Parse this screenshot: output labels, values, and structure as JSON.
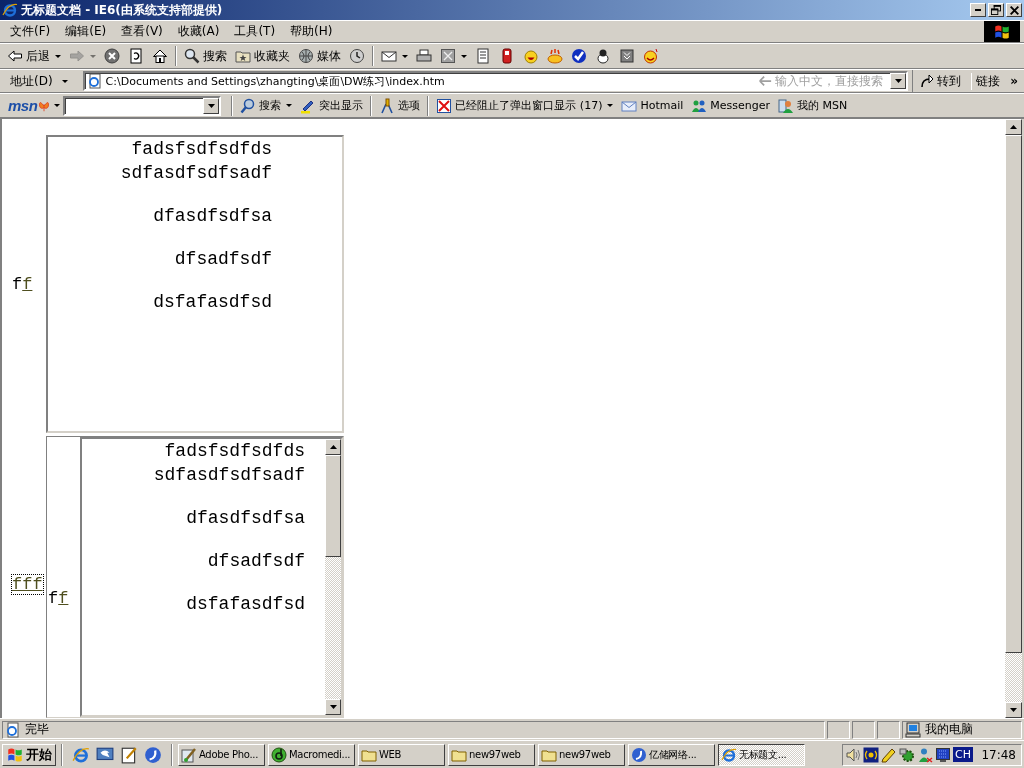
{
  "window": {
    "title": "无标题文档 - IE6(由系统支持部提供)"
  },
  "menu": [
    "文件(F)",
    "编辑(E)",
    "查看(V)",
    "收藏(A)",
    "工具(T)",
    "帮助(H)"
  ],
  "toolbar": {
    "groups": [
      {
        "items": [
          {
            "label": "后退",
            "dropdown": true,
            "disabled": false
          },
          {
            "dropdown": true,
            "disabled": true
          },
          {
            "dropdown": false,
            "disabled": false
          },
          {
            "dropdown": false,
            "disabled": false
          },
          {
            "dropdown": false,
            "disabled": false
          }
        ]
      },
      {
        "items": [
          {
            "label": "搜索",
            "dropdown": false,
            "disabled": false
          },
          {
            "label": "收藏夹",
            "dropdown": false,
            "disabled": false
          },
          {
            "label": "媒体",
            "dropdown": false,
            "disabled": false
          },
          {
            "dropdown": false,
            "disabled": false
          }
        ]
      },
      {
        "items": [
          {
            "dropdown": true,
            "disabled": false
          },
          {
            "dropdown": false,
            "disabled": false
          },
          {
            "dropdown": true,
            "disabled": false
          },
          {
            "dropdown": false,
            "disabled": false
          },
          {
            "dropdown": false,
            "disabled": false
          },
          {
            "dropdown": false,
            "disabled": false
          },
          {
            "dropdown": false,
            "disabled": false
          },
          {
            "dropdown": false,
            "disabled": false
          },
          {
            "dropdown": false,
            "disabled": false
          },
          {
            "dropdown": false,
            "disabled": false
          },
          {
            "dropdown": false,
            "disabled": false
          }
        ]
      }
    ]
  },
  "address_bar": {
    "label": "地址(D)",
    "value": "C:\\Documents and Settings\\zhangting\\桌面\\DW练习\\index.htm",
    "hint": "输入中文，直接搜索",
    "go": "转到",
    "links": "链接",
    "more": "»"
  },
  "msn_bar": {
    "logo": "msn",
    "groups": [
      {
        "items": [
          {
            "label": "搜索",
            "dropdown": true
          },
          {
            "label": "突出显示",
            "dropdown": false
          }
        ]
      },
      {
        "items": [
          {
            "label": "选项",
            "dropdown": false
          }
        ]
      },
      {
        "items": [
          {
            "label": "已经阻止了弹出窗口显示 (17)",
            "dropdown": true
          },
          {
            "label": "Hotmail",
            "dropdown": false
          },
          {
            "label": "Messenger",
            "dropdown": false
          },
          {
            "label": "我的 MSN",
            "dropdown": false
          }
        ]
      }
    ]
  },
  "page": {
    "row_1": {
      "text": "f",
      "link": "f",
      "frame": {
        "paragraphs": [
          [
            "fadsfsdfsdfds",
            "sdfasdfsdfsadf"
          ],
          [
            "dfasdfsdfsa"
          ],
          [
            "dfsadfsdf"
          ],
          [
            "dsfafasdfsd"
          ]
        ]
      }
    },
    "row_2": {
      "link": "fff",
      "focused": true,
      "text": "f",
      "inner_link": "f",
      "frame": {
        "paragraphs": [
          [
            "fadsfsdfsdfds",
            "sdfasdfsdfsadf"
          ],
          [
            "dfasdfsdfsa"
          ],
          [
            "dfsadfsdf"
          ],
          [
            "dsfafasdfsd"
          ]
        ]
      }
    }
  },
  "status_bar": {
    "text": "完毕",
    "zone": "我的电脑"
  },
  "taskbar": {
    "start": "开始",
    "tasks": [
      {
        "label": "Adobe Pho...",
        "selected": false
      },
      {
        "label": "Macromedi...",
        "selected": false
      },
      {
        "label": "WEB",
        "selected": false
      },
      {
        "label": "new97web",
        "selected": false
      },
      {
        "label": "new97web",
        "selected": false
      },
      {
        "label": "亿储网络...",
        "selected": false
      },
      {
        "label": "无标题文...",
        "selected": true
      }
    ],
    "language": "CH",
    "clock": "17:48"
  }
}
